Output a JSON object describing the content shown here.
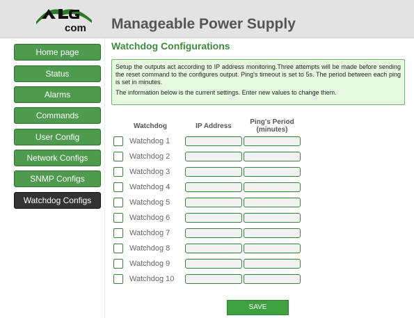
{
  "header": {
    "logo_text": "ALG",
    "logo_subtext": "com",
    "title": "Manageable Power Supply"
  },
  "sidebar": {
    "items": [
      {
        "label": "Home page",
        "active": false
      },
      {
        "label": "Status",
        "active": false
      },
      {
        "label": "Alarms",
        "active": false
      },
      {
        "label": "Commands",
        "active": false
      },
      {
        "label": "User Config",
        "active": false
      },
      {
        "label": "Network Configs",
        "active": false
      },
      {
        "label": "SNMP Configs",
        "active": false
      },
      {
        "label": "Watchdog Configs",
        "active": true
      }
    ]
  },
  "main": {
    "title": "Watchdog Configurations",
    "info": {
      "paragraph1": "Setup the outputs act according to IP address monitoring.Three attempts will be made before sending the reset command to the configures output. Ping's timeout is set to 5s. The period between each ping is set in minutes.",
      "paragraph2": "The information below is the current settings. Enter new values to change them."
    },
    "columns": {
      "watchdog": "Watchdog",
      "ip_address": "IP Address",
      "ping_period_line1": "Ping's Period",
      "ping_period_line2": "(minutes)"
    },
    "rows": [
      {
        "label": "Watchdog 1",
        "checked": false,
        "ip": "",
        "period": ""
      },
      {
        "label": "Watchdog 2",
        "checked": false,
        "ip": "",
        "period": ""
      },
      {
        "label": "Watchdog 3",
        "checked": false,
        "ip": "",
        "period": ""
      },
      {
        "label": "Watchdog 4",
        "checked": false,
        "ip": "",
        "period": ""
      },
      {
        "label": "Watchdog 5",
        "checked": false,
        "ip": "",
        "period": ""
      },
      {
        "label": "Watchdog 6",
        "checked": false,
        "ip": "",
        "period": ""
      },
      {
        "label": "Watchdog 7",
        "checked": false,
        "ip": "",
        "period": ""
      },
      {
        "label": "Watchdog 8",
        "checked": false,
        "ip": "",
        "period": ""
      },
      {
        "label": "Watchdog 9",
        "checked": false,
        "ip": "",
        "period": ""
      },
      {
        "label": "Watchdog 10",
        "checked": false,
        "ip": "",
        "period": ""
      }
    ],
    "save_label": "SAVE"
  },
  "colors": {
    "brand_green": "#3d8a3d",
    "nav_button": "#4e9a4e",
    "nav_active": "#333333",
    "info_background": "#e6f8df",
    "header_background": "#e3e3e3"
  }
}
